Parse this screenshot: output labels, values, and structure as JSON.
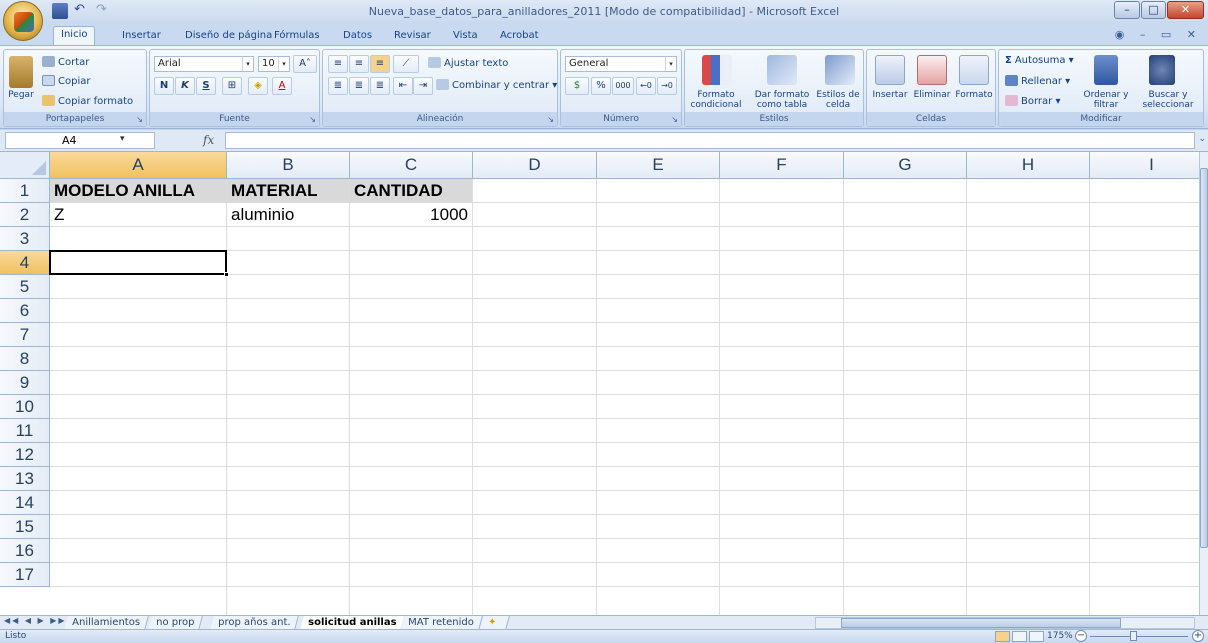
{
  "window": {
    "title": "Nueva_base_datos_para_anilladores_2011  [Modo de compatibilidad]  -  Microsoft Excel"
  },
  "ribbon_tabs": [
    "Inicio",
    "Insertar",
    "Diseño de página",
    "Fórmulas",
    "Datos",
    "Revisar",
    "Vista",
    "Acrobat"
  ],
  "ribbon": {
    "clipboard": {
      "label": "Portapapeles",
      "paste": "Pegar",
      "cut": "Cortar",
      "copy": "Copiar",
      "format_painter": "Copiar formato"
    },
    "font": {
      "label": "Fuente",
      "font_name": "Arial",
      "font_size": "10",
      "bold": "N",
      "italic": "K",
      "underline": "S"
    },
    "alignment": {
      "label": "Alineación",
      "wrap": "Ajustar texto",
      "merge": "Combinar y centrar"
    },
    "number": {
      "label": "Número",
      "format": "General",
      "percent": "%",
      "thousands": "000"
    },
    "styles": {
      "label": "Estilos",
      "conditional": "Formato condicional",
      "as_table": "Dar formato como tabla",
      "cell_styles": "Estilos de celda"
    },
    "cells": {
      "label": "Celdas",
      "insert": "Insertar",
      "delete": "Eliminar",
      "format": "Formato"
    },
    "editing": {
      "label": "Modificar",
      "autosum": "Autosuma",
      "fill": "Rellenar",
      "clear": "Borrar",
      "sort": "Ordenar y filtrar",
      "find": "Buscar y seleccionar"
    }
  },
  "formula_bar": {
    "name_box": "A4",
    "fx": "fx",
    "value": ""
  },
  "columns": [
    "A",
    "B",
    "C",
    "D",
    "E",
    "F",
    "G",
    "H",
    "I"
  ],
  "rows": [
    "1",
    "2",
    "3",
    "4",
    "5",
    "6",
    "7",
    "8",
    "9",
    "10",
    "11",
    "12",
    "13",
    "14",
    "15",
    "16",
    "17"
  ],
  "cells": {
    "A1": "MODELO ANILLA",
    "B1": "MATERIAL",
    "C1": "CANTIDAD",
    "A2": "Z",
    "B2": "aluminio",
    "C2": "1000"
  },
  "active_cell": "A4",
  "sheet_tabs": [
    "Anillamientos",
    "no prop",
    "prop años ant.",
    "solicitud anillas",
    "MAT retenido"
  ],
  "active_sheet": "solicitud anillas",
  "status": {
    "text": "Listo",
    "zoom": "175%"
  },
  "colors": {
    "header_fill": "#d9d9d9",
    "selection_header": "#f1c15f",
    "ribbon": "#dbe7f5"
  }
}
